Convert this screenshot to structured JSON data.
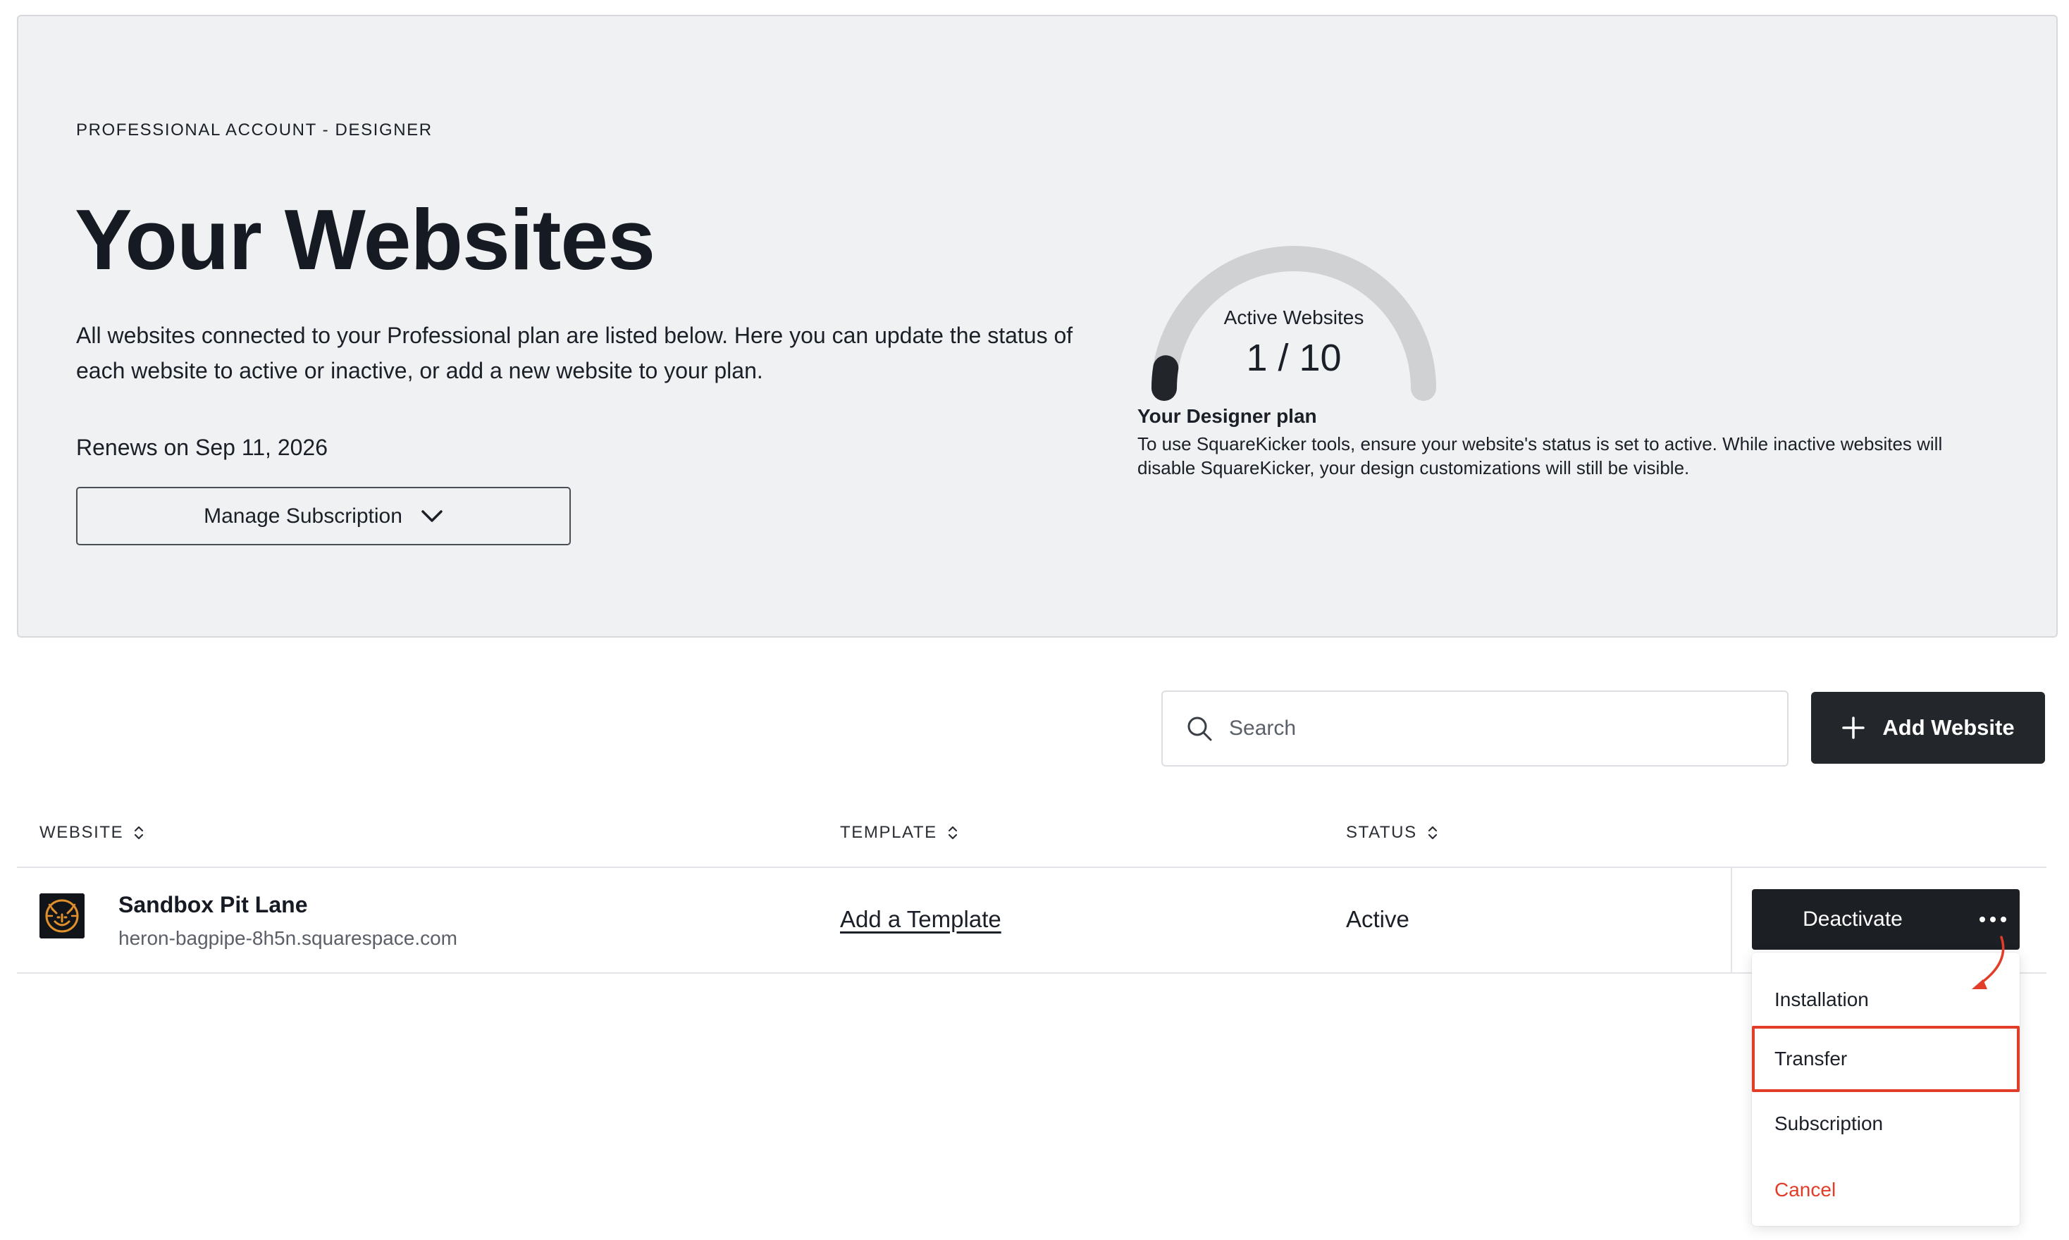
{
  "hero": {
    "eyebrow": "PROFESSIONAL ACCOUNT - DESIGNER",
    "title": "Your Websites",
    "description": "All websites connected to your Professional plan are listed below. Here you can update the status of each website to active or inactive, or add a new website to your plan.",
    "renews": "Renews on Sep 11, 2026",
    "manage_button": "Manage Subscription",
    "manage_icon": "chevron-down-icon"
  },
  "gauge": {
    "label": "Active Websites",
    "value": "1 / 10",
    "active": 1,
    "total": 10,
    "track_color": "#d0d1d3",
    "fill_color": "#22252a"
  },
  "plan": {
    "title": "Your Designer plan",
    "description": "To use SquareKicker tools, ensure your website's status is set to active. While inactive websites will disable SquareKicker, your design customizations will still be visible."
  },
  "toolbar": {
    "search_placeholder": "Search",
    "search_icon": "search-icon",
    "add_button": "Add Website",
    "add_icon": "plus-icon"
  },
  "table": {
    "columns": [
      {
        "label": "WEBSITE",
        "icon": "sort-icon"
      },
      {
        "label": "TEMPLATE",
        "icon": "sort-icon"
      },
      {
        "label": "STATUS",
        "icon": "sort-icon"
      }
    ],
    "rows": [
      {
        "name": "Sandbox Pit Lane",
        "url": "heron-bagpipe-8h5n.squarespace.com",
        "template": "Add a Template",
        "status": "Active",
        "action": "Deactivate",
        "avatar_icon": "lion-logo-icon"
      }
    ]
  },
  "menu": {
    "items": [
      {
        "label": "Installation"
      },
      {
        "label": "Transfer"
      },
      {
        "label": "Subscription"
      },
      {
        "label": "Cancel"
      }
    ],
    "highlighted_item": "Transfer",
    "danger_color": "#e23d28"
  },
  "colors": {
    "hero_bg": "#f0f1f2",
    "dark_button": "#23262b",
    "annotation_red": "#e23d28"
  }
}
